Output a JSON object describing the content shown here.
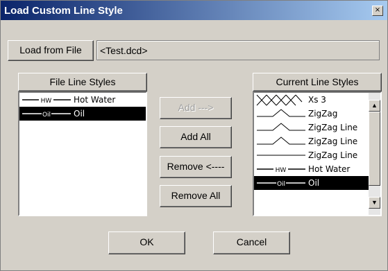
{
  "window": {
    "title": "Load Custom Line Style",
    "close_glyph": "×"
  },
  "load": {
    "button_label": "Load from File",
    "file_value": "<Test.dcd>"
  },
  "file_styles": {
    "header": "File Line Styles",
    "items": [
      {
        "label": "Hot Water",
        "icon": "hw-line-icon",
        "selected": false
      },
      {
        "label": "Oil",
        "icon": "oil-line-icon",
        "selected": true
      }
    ]
  },
  "actions": {
    "add": "Add --->",
    "add_all": "Add All",
    "remove": "Remove <----",
    "remove_all": "Remove All"
  },
  "current_styles": {
    "header": "Current Line Styles",
    "items": [
      {
        "label": "Xs 3",
        "icon": "xs-line-icon",
        "selected": false
      },
      {
        "label": "ZigZag",
        "icon": "zigzag-line-icon",
        "selected": false
      },
      {
        "label": "ZigZag Line",
        "icon": "zigzag-line-icon",
        "selected": false
      },
      {
        "label": "ZigZag Line",
        "icon": "zigzag-line-icon",
        "selected": false
      },
      {
        "label": "ZigZag Line",
        "icon": "plain-line-icon",
        "selected": false
      },
      {
        "label": "Hot Water",
        "icon": "hw-line-icon",
        "selected": false
      },
      {
        "label": "Oil",
        "icon": "oil-line-icon",
        "selected": true
      }
    ]
  },
  "footer": {
    "ok": "OK",
    "cancel": "Cancel"
  },
  "colors": {
    "title_start": "#0a246a",
    "title_end": "#a6caf0",
    "face": "#d4d0c8",
    "selection": "#000000"
  }
}
